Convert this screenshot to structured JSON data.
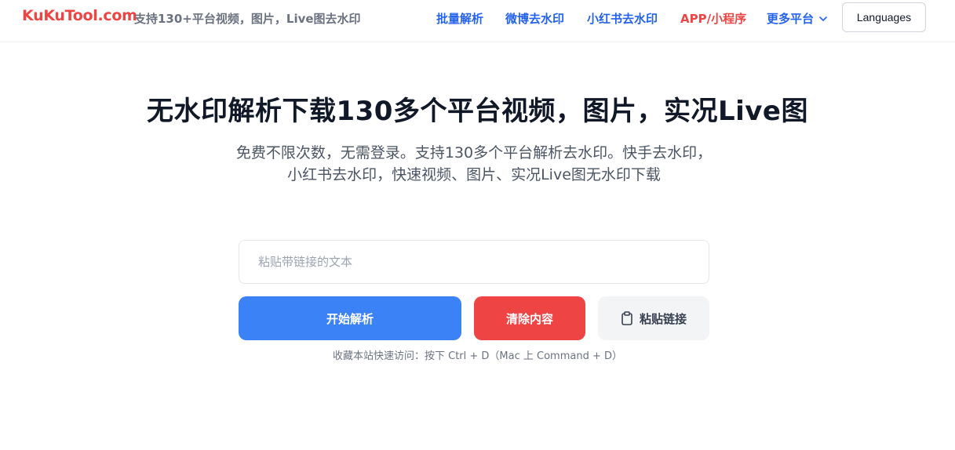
{
  "header": {
    "logo": "KuKuTool.com",
    "tagline": "支持130+平台视频，图片，Live图去水印",
    "nav": {
      "batch": "批量解析",
      "weibo": "微博去水印",
      "xiaohongshu": "小红书去水印",
      "app": "APP/小程序",
      "more": "更多平台"
    },
    "languages_button": "Languages"
  },
  "hero": {
    "title": "无水印解析下载130多个平台视频，图片，实况Live图",
    "subtitle": "免费不限次数，无需登录。支持130多个平台解析去水印。快手去水印，小红书去水印，快速视频、图片、实况Live图无水印下载"
  },
  "form": {
    "input_value": "",
    "input_placeholder": "粘贴带链接的文本",
    "parse_button": "开始解析",
    "clear_button": "清除内容",
    "paste_button": "粘贴链接"
  },
  "hint": "收藏本站快速访问：按下 Ctrl + D（Mac 上 Command + D）",
  "colors": {
    "brand_red": "#ef4444",
    "link_blue": "#2563eb",
    "primary_blue": "#3b82f6",
    "muted_gray": "#f3f4f6"
  },
  "icons": [
    "chevron-down-icon",
    "clipboard-icon"
  ]
}
